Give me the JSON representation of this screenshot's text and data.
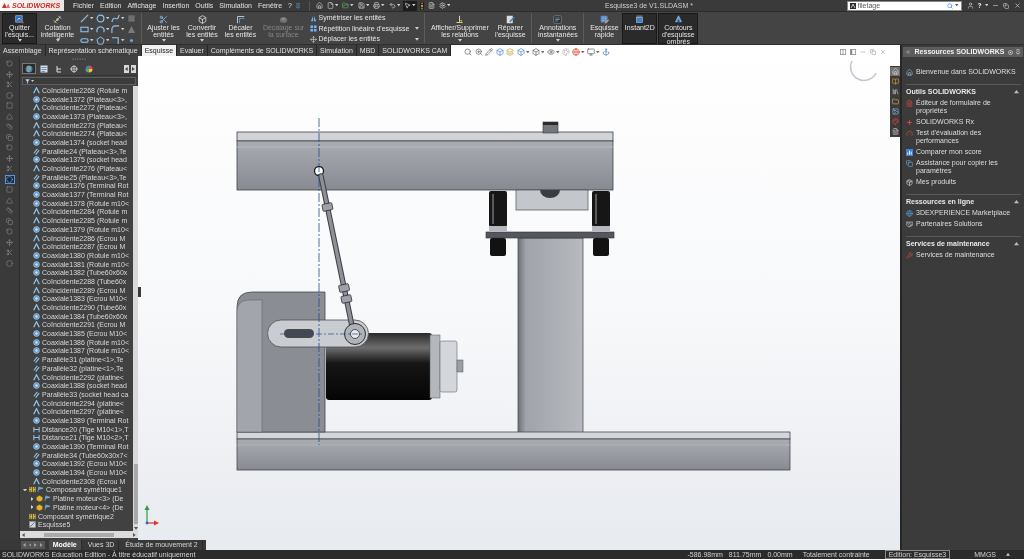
{
  "title_bar": {
    "logo": "SOLIDWORKS",
    "menus": [
      "Fichier",
      "Edition",
      "Affichage",
      "Insertion",
      "Outils",
      "Simulation",
      "Fenêtre",
      "?"
    ],
    "title": "Esquisse3 de V1.SLDASM *",
    "search": {
      "value": "filetage"
    }
  },
  "command_manager": [
    {
      "kind": "large",
      "label": "Quitter l'esquis...",
      "selected": true,
      "disabled": false,
      "dropdown": true
    },
    {
      "kind": "large",
      "label": "Cotation intelligente",
      "selected": false,
      "disabled": false,
      "dropdown": true
    },
    {
      "kind": "tools"
    },
    {
      "kind": "separator"
    },
    {
      "kind": "large",
      "label": "Ajuster les entités",
      "selected": false,
      "disabled": false,
      "dropdown": true
    },
    {
      "kind": "large",
      "label": "Convertir les entités",
      "selected": false,
      "disabled": false,
      "dropdown": true
    },
    {
      "kind": "large",
      "label": "Décaler les entités",
      "selected": false,
      "disabled": false,
      "dropdown": false
    },
    {
      "kind": "large",
      "label": "Décalage sur la surface",
      "selected": false,
      "disabled": true,
      "dropdown": false
    },
    {
      "kind": "list",
      "rows": [
        {
          "label": "Symétriser les entités",
          "dropdown": false
        },
        {
          "label": "Répétition linéaire d'esquisse",
          "dropdown": true
        },
        {
          "label": "Déplacer les entités",
          "dropdown": true
        }
      ]
    },
    {
      "kind": "separator"
    },
    {
      "kind": "large",
      "label": "Afficher/Supprimer les relations",
      "selected": false,
      "disabled": false,
      "dropdown": true
    },
    {
      "kind": "large",
      "label": "Réparer l'esquisse",
      "selected": false,
      "disabled": false,
      "dropdown": false
    },
    {
      "kind": "separator"
    },
    {
      "kind": "large",
      "label": "Annotations instantanées",
      "selected": false,
      "disabled": false,
      "dropdown": true
    },
    {
      "kind": "separator"
    },
    {
      "kind": "large",
      "label": "Esquisse rapide",
      "selected": false,
      "disabled": false,
      "dropdown": false
    },
    {
      "kind": "large",
      "label": "Instant2D",
      "selected": true,
      "disabled": false,
      "dropdown": false
    },
    {
      "kind": "large",
      "label": "Contours d'esquisse ombrés",
      "selected": true,
      "disabled": false,
      "dropdown": false
    }
  ],
  "ribbon_tabs": [
    {
      "label": "Assemblage",
      "selected": false
    },
    {
      "label": "Représentation schématique",
      "selected": false
    },
    {
      "label": "Esquisse",
      "selected": true
    },
    {
      "label": "Evaluer",
      "selected": false
    },
    {
      "label": "Compléments de SOLIDWORKS",
      "selected": false
    },
    {
      "label": "Simulation",
      "selected": false
    },
    {
      "label": "MBD",
      "selected": false
    },
    {
      "label": "SOLIDWORKS CAM",
      "selected": false
    }
  ],
  "left_toolbar": [
    {
      "selected": false
    },
    {
      "selected": false
    },
    {
      "selected": false
    },
    {
      "selected": false
    },
    {
      "selected": false
    },
    {
      "selected": false
    },
    {
      "selected": false
    },
    {
      "selected": false
    },
    {
      "selected": false
    },
    {
      "selected": false
    },
    {
      "selected": false
    },
    {
      "selected": true
    },
    {
      "selected": false
    },
    {
      "selected": false
    },
    {
      "selected": false
    },
    {
      "selected": false
    },
    {
      "selected": false
    },
    {
      "selected": false
    },
    {
      "selected": false
    },
    {
      "selected": false
    }
  ],
  "feature_tree": {
    "tabs": [
      {
        "selected": true
      },
      {
        "selected": false
      },
      {
        "selected": false
      },
      {
        "selected": false
      },
      {
        "selected": false
      }
    ],
    "mates": [
      {
        "kind": "coincident",
        "label": "Coïncidente2268 (Rotule m"
      },
      {
        "kind": "concentric",
        "label": "Coaxiale1372 (Plateau<3>,"
      },
      {
        "kind": "coincident",
        "label": "Coïncidente2272 (Plateau<"
      },
      {
        "kind": "concentric",
        "label": "Coaxiale1373 (Plateau<3>,"
      },
      {
        "kind": "coincident",
        "label": "Coïncidente2273 (Plateau<"
      },
      {
        "kind": "coincident",
        "label": "Coïncidente2274 (Plateau<"
      },
      {
        "kind": "concentric",
        "label": "Coaxiale1374 (socket head"
      },
      {
        "kind": "parallel",
        "label": "Parallèle24 (Plateau<3>,Te"
      },
      {
        "kind": "concentric",
        "label": "Coaxiale1375 (socket head"
      },
      {
        "kind": "coincident",
        "label": "Coïncidente2276 (Plateau<"
      },
      {
        "kind": "parallel",
        "label": "Parallèle25 (Plateau<3>,Te"
      },
      {
        "kind": "concentric",
        "label": "Coaxiale1376 (Terminal Rot"
      },
      {
        "kind": "concentric",
        "label": "Coaxiale1377 (Terminal Rot"
      },
      {
        "kind": "concentric",
        "label": "Coaxiale1378 (Rotule m10<"
      },
      {
        "kind": "coincident",
        "label": "Coïncidente2284 (Rotule m"
      },
      {
        "kind": "coincident",
        "label": "Coïncidente2285 (Rotule m"
      },
      {
        "kind": "concentric",
        "label": "Coaxiale1379 (Rotule m10<"
      },
      {
        "kind": "coincident",
        "label": "Coïncidente2286 (Ecrou M"
      },
      {
        "kind": "coincident",
        "label": "Coïncidente2287 (Ecrou M"
      },
      {
        "kind": "concentric",
        "label": "Coaxiale1380 (Rotule m10<"
      },
      {
        "kind": "concentric",
        "label": "Coaxiale1381 (Rotule m10<"
      },
      {
        "kind": "concentric",
        "label": "Coaxiale1382 (Tube60x60x"
      },
      {
        "kind": "coincident",
        "label": "Coïncidente2288 (Tube60x"
      },
      {
        "kind": "coincident",
        "label": "Coïncidente2289 (Ecrou M"
      },
      {
        "kind": "concentric",
        "label": "Coaxiale1383 (Ecrou M10<"
      },
      {
        "kind": "coincident",
        "label": "Coïncidente2290 (Tube60x"
      },
      {
        "kind": "concentric",
        "label": "Coaxiale1384 (Tube60x60x"
      },
      {
        "kind": "coincident",
        "label": "Coïncidente2291 (Ecrou M"
      },
      {
        "kind": "concentric",
        "label": "Coaxiale1385 (Ecrou M10<"
      },
      {
        "kind": "concentric",
        "label": "Coaxiale1386 (Rotule m10<"
      },
      {
        "kind": "concentric",
        "label": "Coaxiale1387 (Rotule m10<"
      },
      {
        "kind": "parallel",
        "label": "Parallèle31 (platine<1>,Te"
      },
      {
        "kind": "parallel",
        "label": "Parallèle32 (platine<1>,Te"
      },
      {
        "kind": "coincident",
        "label": "Coïncidente2292 (platine<"
      },
      {
        "kind": "concentric",
        "label": "Coaxiale1388 (socket head"
      },
      {
        "kind": "parallel",
        "label": "Parallèle33 (socket head ca"
      },
      {
        "kind": "coincident",
        "label": "Coïncidente2294 (platine<"
      },
      {
        "kind": "coincident",
        "label": "Coïncidente2297 (platine<"
      },
      {
        "kind": "concentric",
        "label": "Coaxiale1389 (Terminal Rot"
      },
      {
        "kind": "distance",
        "label": "Distance20 (Tige M10<1>,T"
      },
      {
        "kind": "distance",
        "label": "Distance21 (Tige M10<2>,T"
      },
      {
        "kind": "concentric",
        "label": "Coaxiale1390 (Terminal Rot"
      },
      {
        "kind": "parallel",
        "label": "Parallèle34 (Tube60x30x7<"
      },
      {
        "kind": "concentric",
        "label": "Coaxiale1392 (Ecrou M10<"
      },
      {
        "kind": "concentric",
        "label": "Coaxiale1394 (Ecrou M10<"
      },
      {
        "kind": "coincident",
        "label": "Coïncidente2308 (Ecrou M"
      }
    ],
    "items": [
      {
        "kind": "mirror-group",
        "label": "Composant symétrique1",
        "expanded": true,
        "children": [
          {
            "kind": "part",
            "label": "Platine moteur<3> (De",
            "expanded": false
          },
          {
            "kind": "part",
            "label": "Platine moteur<4> (De",
            "expanded": false
          }
        ]
      },
      {
        "kind": "mirror",
        "label": "Composant symétrique2"
      },
      {
        "kind": "sketch",
        "label": "Esquisse5"
      }
    ]
  },
  "task_tabs": [
    {
      "selected": true
    },
    {
      "selected": false
    },
    {
      "selected": false
    },
    {
      "selected": false
    },
    {
      "selected": false
    },
    {
      "selected": false
    },
    {
      "selected": false
    }
  ],
  "task_pane": {
    "title": "Ressources SOLIDWORKS",
    "welcome": "Bienvenue dans SOLIDWORKS",
    "sections": [
      {
        "title": "Outils SOLIDWORKS",
        "expanded": true,
        "items": [
          {
            "kind": "form-editor",
            "label": "Éditeur de formulaire de propriétés"
          },
          {
            "kind": "rx",
            "label": "SOLIDWORKS Rx"
          },
          {
            "kind": "benchmark",
            "label": "Test d'évaluation des performances"
          },
          {
            "kind": "score",
            "label": "Comparer mon score"
          },
          {
            "kind": "copy-settings",
            "label": "Assistance pour copier les paramètres"
          },
          {
            "kind": "products",
            "label": "Mes produits"
          }
        ]
      },
      {
        "title": "Ressources en ligne",
        "expanded": true,
        "items": [
          {
            "kind": "marketplace",
            "label": "3DEXPERIENCE Marketplace"
          },
          {
            "kind": "partners",
            "label": "Partenaires Solutions"
          }
        ]
      },
      {
        "title": "Services de maintenance",
        "expanded": true,
        "items": [
          {
            "kind": "maintenance",
            "label": "Services de maintenance"
          }
        ]
      }
    ]
  },
  "bottom_tabs": [
    {
      "label": "Modèle",
      "selected": true
    },
    {
      "label": "Vues 3D",
      "selected": false
    },
    {
      "label": "Étude de mouvement 2",
      "selected": false
    }
  ],
  "status_bar": {
    "edition": "SOLIDWORKS Education Edition - À titre éducatif uniquement",
    "coordinates": [
      "-586.98mm",
      "811.75mm",
      "0.00mm"
    ],
    "sketch_status": "Totalement contrainte",
    "editing": "Edition: Esquisse3",
    "units": "MMGS"
  }
}
